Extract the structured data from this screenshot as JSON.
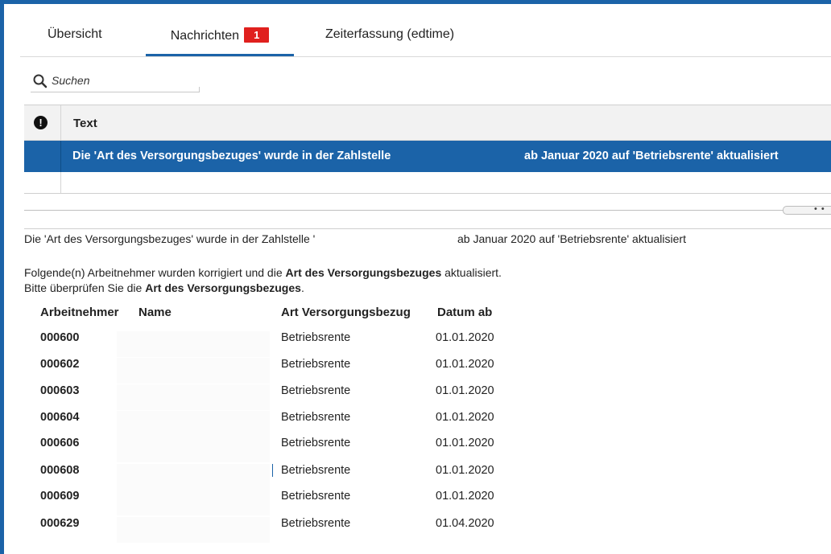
{
  "tabs": [
    {
      "label": "Übersicht",
      "active": false
    },
    {
      "label": "Nachrichten",
      "active": true,
      "badge": "1"
    },
    {
      "label": "Zeiterfassung (edtime)",
      "active": false
    }
  ],
  "search": {
    "placeholder": "Suchen",
    "icon": "search-icon"
  },
  "message_table": {
    "columns": [
      {
        "icon": "exclamation-icon",
        "glyph": "!"
      },
      {
        "label": "Text"
      }
    ],
    "rows": [
      {
        "selected": true,
        "text_part_1": "Die 'Art des Versorgungsbezuges' wurde in der Zahlstelle",
        "text_part_2": "ab Januar 2020 auf 'Betriebsrente' aktualisiert"
      }
    ]
  },
  "splitter": {
    "dots": "• •"
  },
  "detail": {
    "summary_part_1": "Die 'Art des Versorgungsbezuges' wurde in der Zahlstelle '",
    "summary_part_2": "ab Januar 2020 auf 'Betriebsrente' aktualisiert",
    "line2_pre": "Folgende(n) Arbeitnehmer wurden korrigiert und die ",
    "line2_bold": "Art des Versorgungsbezuges",
    "line2_post": " aktualisiert.",
    "line3_pre": "Bitte überprüfen Sie die ",
    "line3_bold": "Art des Versorgungsbezuges",
    "line3_post": ".",
    "table": {
      "headers": {
        "nr": "Arbeitnehmer",
        "name": "Name",
        "art": "Art Versorgungsbezug",
        "date": "Datum ab"
      },
      "rows": [
        {
          "nr": "000600",
          "art": "Betriebsrente",
          "date": "01.01.2020"
        },
        {
          "nr": "000602",
          "art": "Betriebsrente",
          "date": "01.01.2020"
        },
        {
          "nr": "000603",
          "art": "Betriebsrente",
          "date": "01.01.2020"
        },
        {
          "nr": "000604",
          "art": "Betriebsrente",
          "date": "01.01.2020"
        },
        {
          "nr": "000606",
          "art": "Betriebsrente",
          "date": "01.01.2020"
        },
        {
          "nr": "000608",
          "art": "Betriebsrente",
          "date": "01.01.2020"
        },
        {
          "nr": "000609",
          "art": "Betriebsrente",
          "date": "01.01.2020"
        },
        {
          "nr": "000629",
          "art": "Betriebsrente",
          "date": "01.04.2020"
        }
      ]
    }
  },
  "colors": {
    "accent": "#1b63a8",
    "badge": "#e0201e",
    "header_bg": "#f2f2f2"
  }
}
